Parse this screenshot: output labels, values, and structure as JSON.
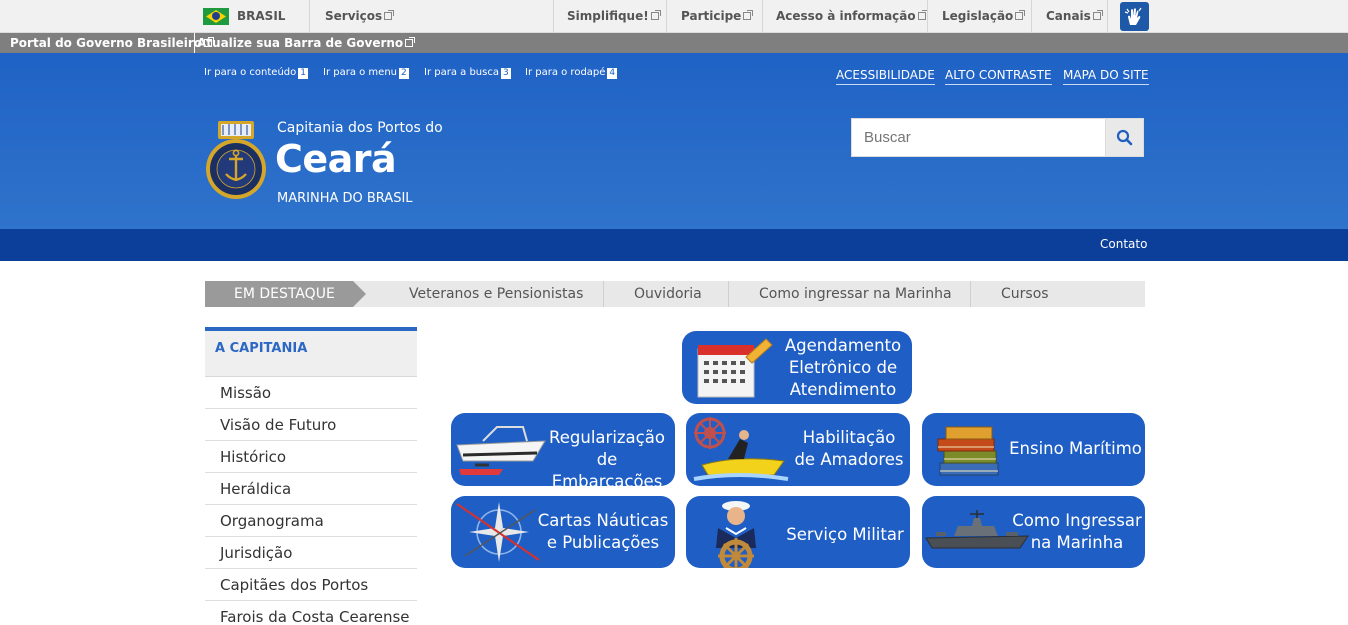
{
  "govbar": {
    "country": "BRASIL",
    "links": [
      "Serviços",
      "Simplifique!",
      "Participe",
      "Acesso à informação",
      "Legislação",
      "Canais"
    ],
    "accessibility_icon": "vlibras-hands-icon"
  },
  "portalbar": {
    "portal_link": "Portal do Governo Brasileiro",
    "update_link": "Atualize sua Barra de Governo"
  },
  "skiplinks": [
    {
      "label": "Ir para o conteúdo",
      "key": "1"
    },
    {
      "label": "Ir para o menu",
      "key": "2"
    },
    {
      "label": "Ir para a busca",
      "key": "3"
    },
    {
      "label": "Ir para o rodapé",
      "key": "4"
    }
  ],
  "accessibility_links": [
    "ACESSIBILIDADE",
    "ALTO CONTRASTE",
    "MAPA DO SITE"
  ],
  "site": {
    "pre_title": "Capitania dos Portos do",
    "title": "Ceará",
    "subtitle": "MARINHA DO BRASIL",
    "seal_text": "MARINHA DO BRASIL"
  },
  "search": {
    "placeholder": "Buscar",
    "icon": "search-icon"
  },
  "navbar": {
    "contact": "Contato"
  },
  "highlights": {
    "label": "EM DESTAQUE",
    "links": [
      "Veteranos e Pensionistas",
      "Ouvidoria",
      "Como ingressar na Marinha",
      "Cursos"
    ]
  },
  "sidebar": {
    "heading": "A CAPITANIA",
    "items": [
      "Missão",
      "Visão de Futuro",
      "Histórico",
      "Heráldica",
      "Organograma",
      "Jurisdição",
      "Capitães dos Portos",
      "Farois da Costa Cearense"
    ]
  },
  "tiles": [
    {
      "label": "Agendamento\nEletrônico de\nAtendimento",
      "icon": "calendar-icon"
    },
    {
      "label": "Regularização\nde Embarcações",
      "icon": "boat-icon"
    },
    {
      "label": "Habilitação\nde Amadores",
      "icon": "jetski-icon"
    },
    {
      "label": "Ensino Marítimo",
      "icon": "books-icon"
    },
    {
      "label": "Cartas Náuticas\ne Publicações",
      "icon": "compass-rose-icon"
    },
    {
      "label": "Serviço Militar",
      "icon": "sailor-icon"
    },
    {
      "label": "Como Ingressar\nna Marinha",
      "icon": "warship-icon"
    }
  ],
  "colors": {
    "header_blue": "#1f62c6",
    "navbar_blue": "#0b3f9a",
    "tile_blue": "#1f5fc5",
    "accent_blue": "#2c67c4"
  }
}
